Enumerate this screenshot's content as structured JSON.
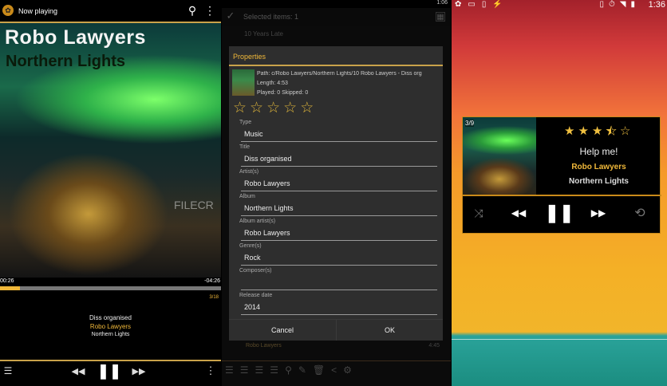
{
  "left": {
    "title": "Now playing",
    "art_artist": "Robo Lawyers",
    "art_album": "Northern Lights",
    "watermark": "FILECR",
    "elapsed": "00:26",
    "remaining": "-04:26",
    "progress_percent": 9,
    "track_position": "3/18",
    "song": "Diss organised",
    "artist": "Robo Lawyers",
    "album": "Northern Lights"
  },
  "middle": {
    "status_time": "1:06",
    "selection": "Selected items: 1",
    "list_item_1": "10 Years Late",
    "list_item_bottom": "Robo Lawyers",
    "list_item_bottom_time": "4:45",
    "dialog": {
      "title": "Properties",
      "path": "Path: c/Robo Lawyers/Northern Lights/10 Robo Lawyers - Diss org",
      "length": "Length: 4:53",
      "played": "Played: 0 Skipped: 0",
      "rating": 0,
      "fields": [
        {
          "label": "Type",
          "value": "Music"
        },
        {
          "label": "Title",
          "value": "Diss organised"
        },
        {
          "label": "Artist(s)",
          "value": "Robo Lawyers"
        },
        {
          "label": "Album",
          "value": "Northern Lights"
        },
        {
          "label": "Album artist(s)",
          "value": "Robo Lawyers"
        },
        {
          "label": "Genre(s)",
          "value": "Rock"
        },
        {
          "label": "Composer(s)",
          "value": ""
        },
        {
          "label": "Release date",
          "value": "2014"
        }
      ],
      "cancel": "Cancel",
      "ok": "OK"
    }
  },
  "right": {
    "status_time": "1:36",
    "widget": {
      "track_position": "3/9",
      "rating": 3.5,
      "song": "Help me!",
      "artist": "Robo Lawyers",
      "album": "Northern Lights"
    }
  },
  "colors": {
    "accent": "#f0b83a",
    "dialog": "#2e2e2e"
  }
}
